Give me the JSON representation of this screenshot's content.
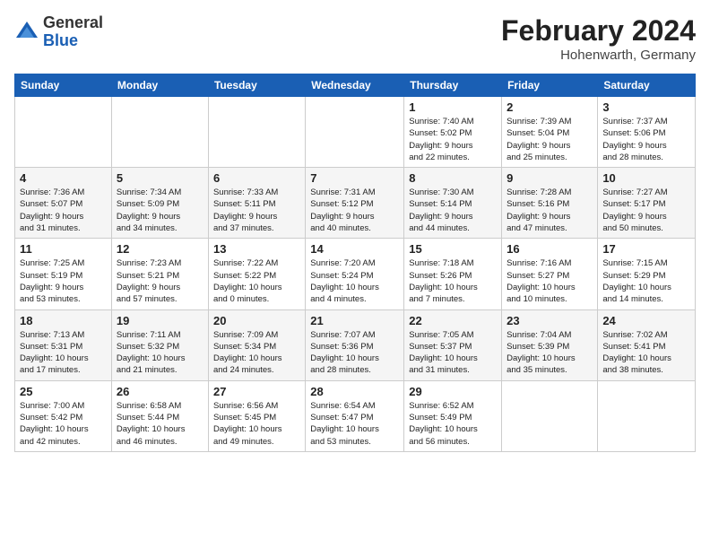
{
  "header": {
    "logo_general": "General",
    "logo_blue": "Blue",
    "month_year": "February 2024",
    "location": "Hohenwarth, Germany"
  },
  "weekdays": [
    "Sunday",
    "Monday",
    "Tuesday",
    "Wednesday",
    "Thursday",
    "Friday",
    "Saturday"
  ],
  "weeks": [
    [
      {
        "day": "",
        "info": ""
      },
      {
        "day": "",
        "info": ""
      },
      {
        "day": "",
        "info": ""
      },
      {
        "day": "",
        "info": ""
      },
      {
        "day": "1",
        "info": "Sunrise: 7:40 AM\nSunset: 5:02 PM\nDaylight: 9 hours\nand 22 minutes."
      },
      {
        "day": "2",
        "info": "Sunrise: 7:39 AM\nSunset: 5:04 PM\nDaylight: 9 hours\nand 25 minutes."
      },
      {
        "day": "3",
        "info": "Sunrise: 7:37 AM\nSunset: 5:06 PM\nDaylight: 9 hours\nand 28 minutes."
      }
    ],
    [
      {
        "day": "4",
        "info": "Sunrise: 7:36 AM\nSunset: 5:07 PM\nDaylight: 9 hours\nand 31 minutes."
      },
      {
        "day": "5",
        "info": "Sunrise: 7:34 AM\nSunset: 5:09 PM\nDaylight: 9 hours\nand 34 minutes."
      },
      {
        "day": "6",
        "info": "Sunrise: 7:33 AM\nSunset: 5:11 PM\nDaylight: 9 hours\nand 37 minutes."
      },
      {
        "day": "7",
        "info": "Sunrise: 7:31 AM\nSunset: 5:12 PM\nDaylight: 9 hours\nand 40 minutes."
      },
      {
        "day": "8",
        "info": "Sunrise: 7:30 AM\nSunset: 5:14 PM\nDaylight: 9 hours\nand 44 minutes."
      },
      {
        "day": "9",
        "info": "Sunrise: 7:28 AM\nSunset: 5:16 PM\nDaylight: 9 hours\nand 47 minutes."
      },
      {
        "day": "10",
        "info": "Sunrise: 7:27 AM\nSunset: 5:17 PM\nDaylight: 9 hours\nand 50 minutes."
      }
    ],
    [
      {
        "day": "11",
        "info": "Sunrise: 7:25 AM\nSunset: 5:19 PM\nDaylight: 9 hours\nand 53 minutes."
      },
      {
        "day": "12",
        "info": "Sunrise: 7:23 AM\nSunset: 5:21 PM\nDaylight: 9 hours\nand 57 minutes."
      },
      {
        "day": "13",
        "info": "Sunrise: 7:22 AM\nSunset: 5:22 PM\nDaylight: 10 hours\nand 0 minutes."
      },
      {
        "day": "14",
        "info": "Sunrise: 7:20 AM\nSunset: 5:24 PM\nDaylight: 10 hours\nand 4 minutes."
      },
      {
        "day": "15",
        "info": "Sunrise: 7:18 AM\nSunset: 5:26 PM\nDaylight: 10 hours\nand 7 minutes."
      },
      {
        "day": "16",
        "info": "Sunrise: 7:16 AM\nSunset: 5:27 PM\nDaylight: 10 hours\nand 10 minutes."
      },
      {
        "day": "17",
        "info": "Sunrise: 7:15 AM\nSunset: 5:29 PM\nDaylight: 10 hours\nand 14 minutes."
      }
    ],
    [
      {
        "day": "18",
        "info": "Sunrise: 7:13 AM\nSunset: 5:31 PM\nDaylight: 10 hours\nand 17 minutes."
      },
      {
        "day": "19",
        "info": "Sunrise: 7:11 AM\nSunset: 5:32 PM\nDaylight: 10 hours\nand 21 minutes."
      },
      {
        "day": "20",
        "info": "Sunrise: 7:09 AM\nSunset: 5:34 PM\nDaylight: 10 hours\nand 24 minutes."
      },
      {
        "day": "21",
        "info": "Sunrise: 7:07 AM\nSunset: 5:36 PM\nDaylight: 10 hours\nand 28 minutes."
      },
      {
        "day": "22",
        "info": "Sunrise: 7:05 AM\nSunset: 5:37 PM\nDaylight: 10 hours\nand 31 minutes."
      },
      {
        "day": "23",
        "info": "Sunrise: 7:04 AM\nSunset: 5:39 PM\nDaylight: 10 hours\nand 35 minutes."
      },
      {
        "day": "24",
        "info": "Sunrise: 7:02 AM\nSunset: 5:41 PM\nDaylight: 10 hours\nand 38 minutes."
      }
    ],
    [
      {
        "day": "25",
        "info": "Sunrise: 7:00 AM\nSunset: 5:42 PM\nDaylight: 10 hours\nand 42 minutes."
      },
      {
        "day": "26",
        "info": "Sunrise: 6:58 AM\nSunset: 5:44 PM\nDaylight: 10 hours\nand 46 minutes."
      },
      {
        "day": "27",
        "info": "Sunrise: 6:56 AM\nSunset: 5:45 PM\nDaylight: 10 hours\nand 49 minutes."
      },
      {
        "day": "28",
        "info": "Sunrise: 6:54 AM\nSunset: 5:47 PM\nDaylight: 10 hours\nand 53 minutes."
      },
      {
        "day": "29",
        "info": "Sunrise: 6:52 AM\nSunset: 5:49 PM\nDaylight: 10 hours\nand 56 minutes."
      },
      {
        "day": "",
        "info": ""
      },
      {
        "day": "",
        "info": ""
      }
    ]
  ]
}
